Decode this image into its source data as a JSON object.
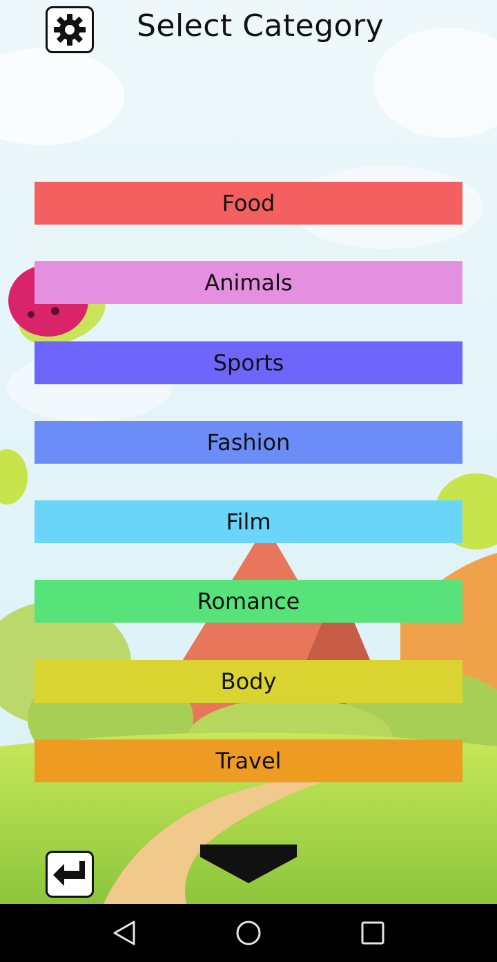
{
  "header": {
    "title": "Select Category",
    "settings_icon": "gear-icon"
  },
  "categories": [
    {
      "label": "Food",
      "color": "#F4605F"
    },
    {
      "label": "Animals",
      "color": "#E58FE0"
    },
    {
      "label": "Sports",
      "color": "#6E66FA"
    },
    {
      "label": "Fashion",
      "color": "#6C8DF8"
    },
    {
      "label": "Film",
      "color": "#6AD5F8"
    },
    {
      "label": "Romance",
      "color": "#57E37A"
    },
    {
      "label": "Body",
      "color": "#D9D430"
    },
    {
      "label": "Travel",
      "color": "#EE9B22"
    }
  ],
  "footer": {
    "back_icon": "return-arrow-icon",
    "scroll_icon": "chevron-down-icon"
  },
  "system_nav": {
    "back": "triangle-back-icon",
    "home": "circle-home-icon",
    "recents": "square-recents-icon"
  }
}
